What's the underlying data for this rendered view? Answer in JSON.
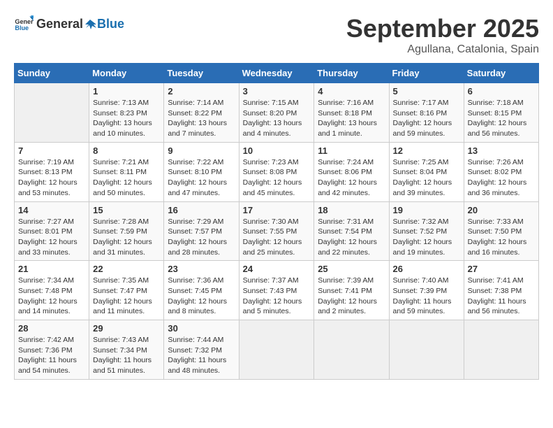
{
  "logo": {
    "text_general": "General",
    "text_blue": "Blue"
  },
  "title": {
    "month": "September 2025",
    "location": "Agullana, Catalonia, Spain"
  },
  "weekdays": [
    "Sunday",
    "Monday",
    "Tuesday",
    "Wednesday",
    "Thursday",
    "Friday",
    "Saturday"
  ],
  "weeks": [
    [
      {
        "day": null
      },
      {
        "day": "1",
        "sunrise": "7:13 AM",
        "sunset": "8:23 PM",
        "daylight": "13 hours and 10 minutes."
      },
      {
        "day": "2",
        "sunrise": "7:14 AM",
        "sunset": "8:22 PM",
        "daylight": "13 hours and 7 minutes."
      },
      {
        "day": "3",
        "sunrise": "7:15 AM",
        "sunset": "8:20 PM",
        "daylight": "13 hours and 4 minutes."
      },
      {
        "day": "4",
        "sunrise": "7:16 AM",
        "sunset": "8:18 PM",
        "daylight": "13 hours and 1 minute."
      },
      {
        "day": "5",
        "sunrise": "7:17 AM",
        "sunset": "8:16 PM",
        "daylight": "12 hours and 59 minutes."
      },
      {
        "day": "6",
        "sunrise": "7:18 AM",
        "sunset": "8:15 PM",
        "daylight": "12 hours and 56 minutes."
      }
    ],
    [
      {
        "day": "7",
        "sunrise": "7:19 AM",
        "sunset": "8:13 PM",
        "daylight": "12 hours and 53 minutes."
      },
      {
        "day": "8",
        "sunrise": "7:21 AM",
        "sunset": "8:11 PM",
        "daylight": "12 hours and 50 minutes."
      },
      {
        "day": "9",
        "sunrise": "7:22 AM",
        "sunset": "8:10 PM",
        "daylight": "12 hours and 47 minutes."
      },
      {
        "day": "10",
        "sunrise": "7:23 AM",
        "sunset": "8:08 PM",
        "daylight": "12 hours and 45 minutes."
      },
      {
        "day": "11",
        "sunrise": "7:24 AM",
        "sunset": "8:06 PM",
        "daylight": "12 hours and 42 minutes."
      },
      {
        "day": "12",
        "sunrise": "7:25 AM",
        "sunset": "8:04 PM",
        "daylight": "12 hours and 39 minutes."
      },
      {
        "day": "13",
        "sunrise": "7:26 AM",
        "sunset": "8:02 PM",
        "daylight": "12 hours and 36 minutes."
      }
    ],
    [
      {
        "day": "14",
        "sunrise": "7:27 AM",
        "sunset": "8:01 PM",
        "daylight": "12 hours and 33 minutes."
      },
      {
        "day": "15",
        "sunrise": "7:28 AM",
        "sunset": "7:59 PM",
        "daylight": "12 hours and 31 minutes."
      },
      {
        "day": "16",
        "sunrise": "7:29 AM",
        "sunset": "7:57 PM",
        "daylight": "12 hours and 28 minutes."
      },
      {
        "day": "17",
        "sunrise": "7:30 AM",
        "sunset": "7:55 PM",
        "daylight": "12 hours and 25 minutes."
      },
      {
        "day": "18",
        "sunrise": "7:31 AM",
        "sunset": "7:54 PM",
        "daylight": "12 hours and 22 minutes."
      },
      {
        "day": "19",
        "sunrise": "7:32 AM",
        "sunset": "7:52 PM",
        "daylight": "12 hours and 19 minutes."
      },
      {
        "day": "20",
        "sunrise": "7:33 AM",
        "sunset": "7:50 PM",
        "daylight": "12 hours and 16 minutes."
      }
    ],
    [
      {
        "day": "21",
        "sunrise": "7:34 AM",
        "sunset": "7:48 PM",
        "daylight": "12 hours and 14 minutes."
      },
      {
        "day": "22",
        "sunrise": "7:35 AM",
        "sunset": "7:47 PM",
        "daylight": "12 hours and 11 minutes."
      },
      {
        "day": "23",
        "sunrise": "7:36 AM",
        "sunset": "7:45 PM",
        "daylight": "12 hours and 8 minutes."
      },
      {
        "day": "24",
        "sunrise": "7:37 AM",
        "sunset": "7:43 PM",
        "daylight": "12 hours and 5 minutes."
      },
      {
        "day": "25",
        "sunrise": "7:39 AM",
        "sunset": "7:41 PM",
        "daylight": "12 hours and 2 minutes."
      },
      {
        "day": "26",
        "sunrise": "7:40 AM",
        "sunset": "7:39 PM",
        "daylight": "11 hours and 59 minutes."
      },
      {
        "day": "27",
        "sunrise": "7:41 AM",
        "sunset": "7:38 PM",
        "daylight": "11 hours and 56 minutes."
      }
    ],
    [
      {
        "day": "28",
        "sunrise": "7:42 AM",
        "sunset": "7:36 PM",
        "daylight": "11 hours and 54 minutes."
      },
      {
        "day": "29",
        "sunrise": "7:43 AM",
        "sunset": "7:34 PM",
        "daylight": "11 hours and 51 minutes."
      },
      {
        "day": "30",
        "sunrise": "7:44 AM",
        "sunset": "7:32 PM",
        "daylight": "11 hours and 48 minutes."
      },
      {
        "day": null
      },
      {
        "day": null
      },
      {
        "day": null
      },
      {
        "day": null
      }
    ]
  ]
}
